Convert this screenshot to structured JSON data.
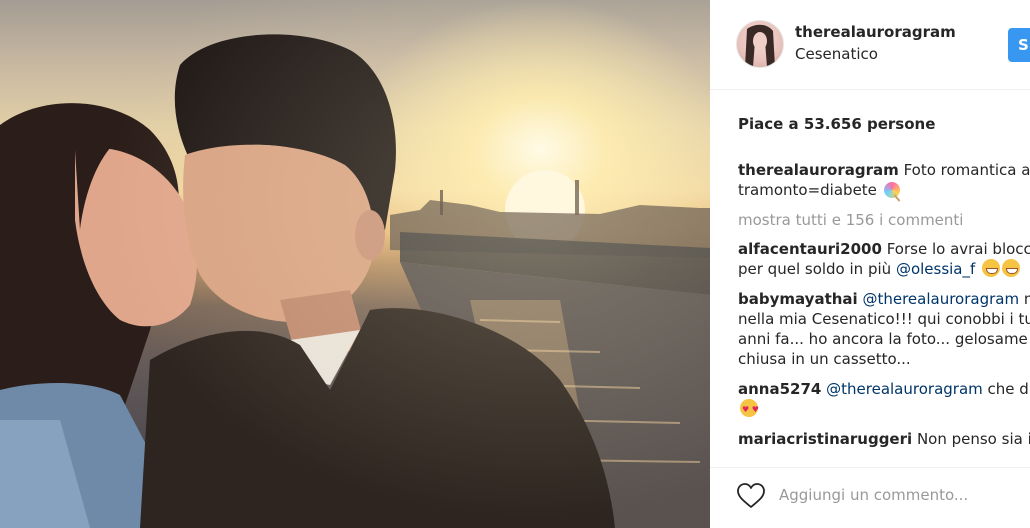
{
  "post": {
    "username": "therealauroragram",
    "location": "Cesenatico",
    "follow_label": "S",
    "likes_text": "Piace a 53.656 persone"
  },
  "caption": {
    "username": "therealauroragram",
    "text_line1": "Foto romantica al",
    "text_line2": "tramonto=diabete",
    "emoji": "lollipop"
  },
  "view_all_comments": "mostra tutti e 156 i commenti",
  "comments": [
    {
      "username": "alfacentauri2000",
      "text_line1": "Forse lo avrai blocc",
      "text_line2_pre": "per quel soldo in più",
      "mention": "@olessia_f",
      "emoji": "grinning"
    },
    {
      "username": "babymayathai",
      "mention": "@therealauroragram",
      "text_line1_post": "m",
      "text_line2": "nella mia Cesenatico!!! qui conobbi i tu",
      "text_line3": "anni fa... ho ancora la foto... gelosame",
      "text_line4": "chiusa in un cassetto..."
    },
    {
      "username": "anna5274",
      "mention": "@therealauroragram",
      "text_line1_post": "che d",
      "emoji": "heart-eyes"
    },
    {
      "username": "mariacristinaruggeri",
      "text_line1": "Non penso sia il"
    }
  ],
  "footer": {
    "add_comment_placeholder": "Aggiungi un commento..."
  },
  "colors": {
    "follow_button": "#3897f0",
    "mention": "#003569",
    "muted": "#999999"
  }
}
